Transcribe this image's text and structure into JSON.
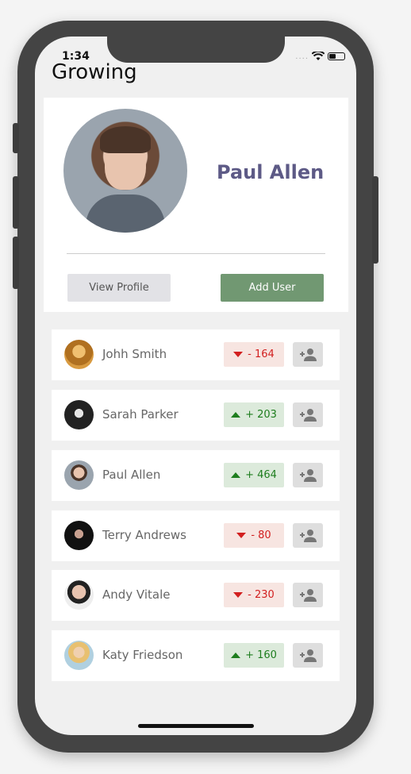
{
  "status_bar": {
    "time": "1:34",
    "signal": "....",
    "wifi_icon": "wifi-icon",
    "battery_icon": "battery-icon",
    "battery_level": 0.45
  },
  "header": {
    "title": "Growing"
  },
  "profile": {
    "name": "Paul Allen",
    "view_profile_label": "View Profile",
    "add_user_label": "Add User",
    "name_color": "#5d5a86",
    "add_button_color": "#719872"
  },
  "users": [
    {
      "name": "Johh Smith",
      "change": "- 164",
      "trend": "down"
    },
    {
      "name": "Sarah Parker",
      "change": "+ 203",
      "trend": "up"
    },
    {
      "name": "Paul Allen",
      "change": "+ 464",
      "trend": "up"
    },
    {
      "name": "Terry Andrews",
      "change": "- 80",
      "trend": "down"
    },
    {
      "name": "Andy Vitale",
      "change": "- 230",
      "trend": "down"
    },
    {
      "name": "Katy Friedson",
      "change": "+ 160",
      "trend": "up"
    }
  ],
  "colors": {
    "down": "#d21f1f",
    "up": "#1e7d1e"
  },
  "icons": {
    "add_user": "add-user-icon",
    "trend_down": "caret-down-icon",
    "trend_up": "caret-up-icon"
  }
}
